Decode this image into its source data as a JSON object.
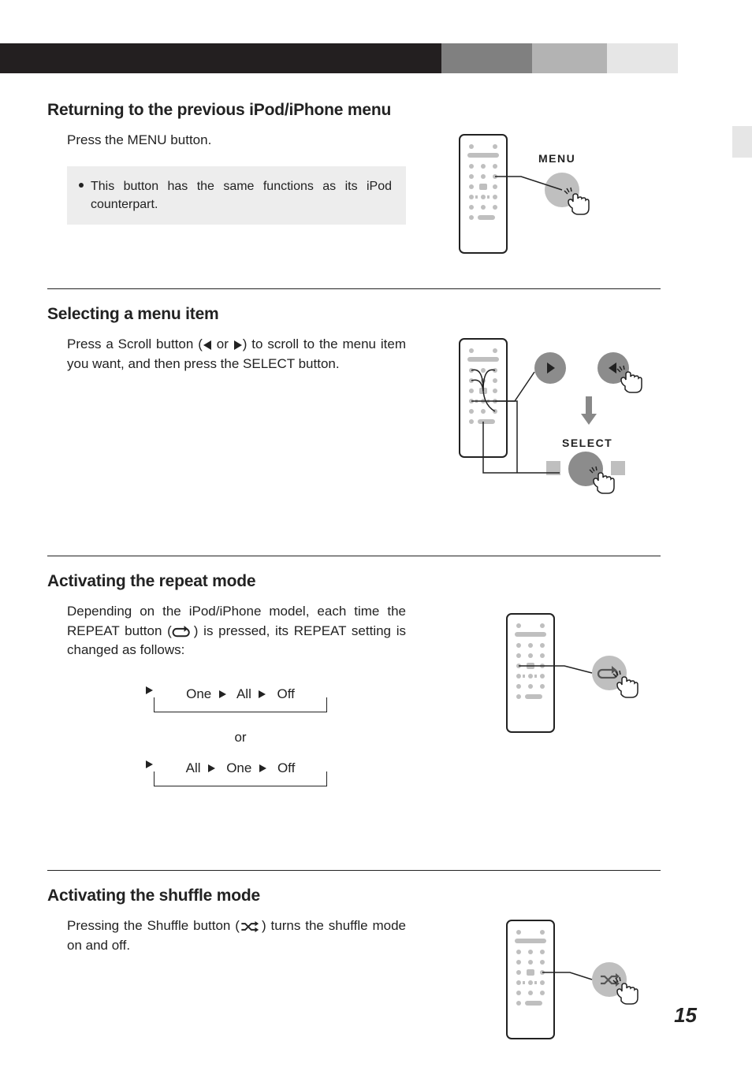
{
  "page_number": "15",
  "sections": {
    "s1": {
      "title": "Returning to the previous iPod/iPhone menu",
      "body": "Press the MENU button.",
      "note": "This button has the same functions as its iPod counterpart.",
      "label": "MENU"
    },
    "s2": {
      "title": "Selecting a menu item",
      "body_a": "Press a Scroll button (",
      "body_b": " or ",
      "body_c": ") to scroll to the menu item you want, and then press the SELECT button.",
      "label": "SELECT"
    },
    "s3": {
      "title": "Activating the repeat mode",
      "body_a": "Depending on the iPod/iPhone model, each time the REPEAT button (",
      "body_b": ") is pressed, its REPEAT setting is changed as follows:",
      "cycle1": {
        "a": "One",
        "b": "All",
        "c": "Off"
      },
      "or": "or",
      "cycle2": {
        "a": "All",
        "b": "One",
        "c": "Off"
      }
    },
    "s4": {
      "title": "Activating the shuffle mode",
      "body_a": "Pressing the Shuffle button (",
      "body_b": ") turns the shuffle mode on and off."
    }
  }
}
